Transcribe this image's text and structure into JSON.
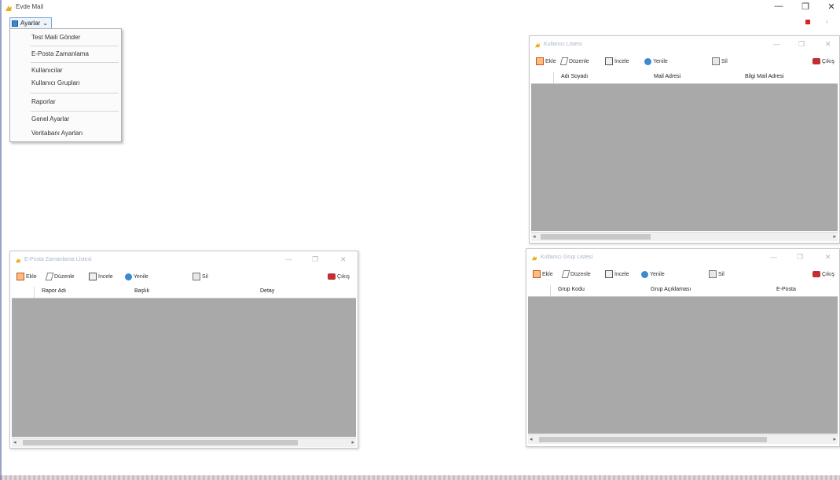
{
  "app": {
    "title": "Evde Mail",
    "accent": "#3a86d0"
  },
  "window_controls": {
    "minimize": "—",
    "maximize": "❐",
    "close": "✕"
  },
  "menu": {
    "button_label": "Ayarlar",
    "caret": "⌄",
    "items": [
      {
        "label": "Test Maili Gönder"
      },
      {
        "label": "E-Posta Zamanlama"
      },
      {
        "label": "Kullanıcılar"
      },
      {
        "label": "Kullanıcı Grupları"
      },
      {
        "label": "Raporlar"
      },
      {
        "label": "Genel Ayarlar"
      },
      {
        "label": "Veritabanı Ayarları"
      }
    ]
  },
  "toolbar": {
    "add": "Ekle",
    "edit": "Düzenle",
    "view": "İncele",
    "refresh": "Yenile",
    "delete": "Sil",
    "exit": "Çıkış",
    "exit_short": "Çıkış"
  },
  "windows": {
    "users": {
      "title": "Kullanıcı Listesi",
      "columns": [
        "Adı Soyadı",
        "Mail Adresi",
        "Bilgi Mail Adresi"
      ]
    },
    "schedule": {
      "title": "E-Posta Zamanlama Listesi",
      "columns": [
        "Rapor Adı",
        "Başlık",
        "Detay"
      ]
    },
    "groups": {
      "title": "Kullanıcı Grup Listesi",
      "columns": [
        "Grup Kodu",
        "Grup Açıklaması",
        "E-Posta"
      ]
    }
  },
  "scroll": {
    "left": "◂",
    "right": "▸"
  }
}
